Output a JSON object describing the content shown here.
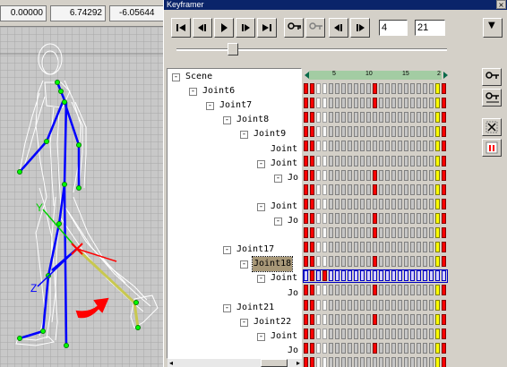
{
  "viewport": {
    "coords": [
      "0.00000",
      "6.74292",
      "-6.05644"
    ],
    "axis_labels": {
      "y": "Y",
      "z": "Z"
    }
  },
  "keyframer": {
    "title": "Keyframer",
    "close_glyph": "×",
    "current_frame": "4",
    "total_frames": "21",
    "dropdown_glyph": "▼",
    "slider_value": 0.19,
    "ruler_ticks": [
      "5",
      "10",
      "15",
      "2"
    ],
    "toolbar": [
      {
        "name": "go-start-button",
        "icon": "skip-start-icon"
      },
      {
        "name": "prev-key-button",
        "icon": "prev-key-icon"
      },
      {
        "name": "play-button",
        "icon": "play-icon"
      },
      {
        "name": "next-key-button",
        "icon": "next-key-icon"
      },
      {
        "name": "go-end-button",
        "icon": "skip-end-icon"
      },
      {
        "name": "key-mode-button",
        "icon": "key-icon"
      },
      {
        "name": "key-filter-button",
        "icon": "key-outline-icon"
      },
      {
        "name": "prev-frame-button",
        "icon": "step-back-icon"
      },
      {
        "name": "next-frame-button",
        "icon": "step-forward-icon"
      }
    ],
    "side_toolbar": [
      {
        "name": "add-key-button",
        "icon": "key-add-icon"
      },
      {
        "name": "move-key-button",
        "icon": "key-move-icon"
      },
      {
        "name": "delete-key-button",
        "icon": "delete-key-icon"
      },
      {
        "name": "key-info-button",
        "icon": "key-info-icon"
      }
    ],
    "tree": [
      {
        "label": "Scene",
        "indent": 0,
        "expander": "-",
        "selected": false
      },
      {
        "label": "Joint6",
        "indent": 1,
        "expander": "-",
        "selected": false
      },
      {
        "label": "Joint7",
        "indent": 2,
        "expander": "-",
        "selected": false
      },
      {
        "label": "Joint8",
        "indent": 3,
        "expander": "-",
        "selected": false
      },
      {
        "label": "Joint9",
        "indent": 4,
        "expander": "-",
        "selected": false
      },
      {
        "label": "Joint",
        "indent": 5,
        "expander": "",
        "selected": false
      },
      {
        "label": "Joint",
        "indent": 5,
        "expander": "-",
        "selected": false
      },
      {
        "label": "Jo",
        "indent": 6,
        "expander": "-",
        "selected": false
      },
      {
        "label": "",
        "indent": 6,
        "expander": "",
        "selected": false
      },
      {
        "label": "Joint",
        "indent": 5,
        "expander": "-",
        "selected": false
      },
      {
        "label": "Jo",
        "indent": 6,
        "expander": "-",
        "selected": false
      },
      {
        "label": "",
        "indent": 6,
        "expander": "",
        "selected": false
      },
      {
        "label": "Joint17",
        "indent": 3,
        "expander": "-",
        "selected": false
      },
      {
        "label": "Joint18",
        "indent": 4,
        "expander": "-",
        "selected": true
      },
      {
        "label": "Joint",
        "indent": 5,
        "expander": "-",
        "selected": false
      },
      {
        "label": "Jo",
        "indent": 6,
        "expander": "",
        "selected": false
      },
      {
        "label": "Joint21",
        "indent": 3,
        "expander": "-",
        "selected": false
      },
      {
        "label": "Joint22",
        "indent": 4,
        "expander": "-",
        "selected": false
      },
      {
        "label": "Joint",
        "indent": 5,
        "expander": "-",
        "selected": false
      },
      {
        "label": "Jo",
        "indent": 6,
        "expander": "",
        "selected": false
      }
    ],
    "track_rows": [
      {
        "keys": [
          1,
          11,
          21
        ],
        "selected": false
      },
      {
        "keys": [
          1,
          11,
          21
        ],
        "selected": false
      },
      {
        "keys": [
          1,
          21
        ],
        "selected": false
      },
      {
        "keys": [
          1,
          21
        ],
        "selected": false
      },
      {
        "keys": [
          1,
          21
        ],
        "selected": false
      },
      {
        "keys": [
          1,
          21
        ],
        "selected": false
      },
      {
        "keys": [
          1,
          11,
          21
        ],
        "selected": false
      },
      {
        "keys": [
          1,
          11,
          21
        ],
        "selected": false
      },
      {
        "keys": [
          1,
          21
        ],
        "selected": false
      },
      {
        "keys": [
          1,
          11,
          21
        ],
        "selected": false
      },
      {
        "keys": [
          1,
          11,
          21
        ],
        "selected": false
      },
      {
        "keys": [
          1,
          21
        ],
        "selected": false
      },
      {
        "keys": [
          1,
          11,
          21
        ],
        "selected": false
      },
      {
        "keys": [
          1,
          3
        ],
        "selected": true
      },
      {
        "keys": [
          1,
          11,
          21
        ],
        "selected": false
      },
      {
        "keys": [
          1,
          21
        ],
        "selected": false
      },
      {
        "keys": [
          1,
          11,
          21
        ],
        "selected": false
      },
      {
        "keys": [
          1,
          21
        ],
        "selected": false
      },
      {
        "keys": [
          1,
          11,
          21
        ],
        "selected": false
      },
      {
        "keys": [
          1,
          21
        ],
        "selected": false
      }
    ],
    "colors": {
      "key": "#ff0000",
      "current_frame": "#ffff00",
      "selected_row": "#0000c0",
      "selected_label": "#a89878",
      "title_bar": "#0a246a",
      "ruler": "#a3cca3"
    }
  }
}
